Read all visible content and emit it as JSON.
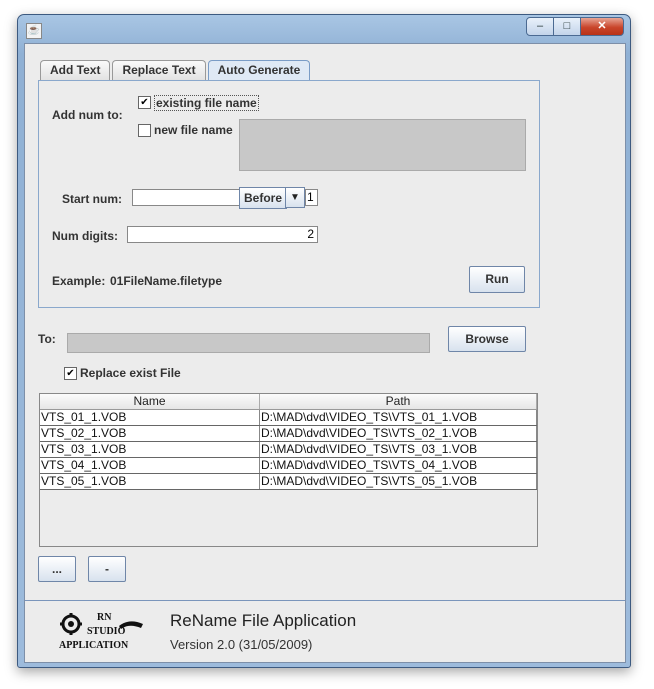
{
  "window": {
    "title": "",
    "controls": {
      "minimize": "‒",
      "maximize": "□",
      "close": "✕"
    }
  },
  "tabs": [
    {
      "label": "Add Text",
      "active": false
    },
    {
      "label": "Replace Text",
      "active": false
    },
    {
      "label": "Auto Generate",
      "active": true
    }
  ],
  "auto_generate": {
    "add_num_label": "Add num to:",
    "existing_file_name": {
      "label": "existing file name",
      "checked": true
    },
    "new_file_name": {
      "label": "new file name",
      "checked": false
    },
    "start_num_label": "Start num:",
    "start_num_value": "",
    "position_select": "Before",
    "position_value": "1",
    "num_digits_label": "Num digits:",
    "num_digits_value": "2",
    "example_label": "Example:",
    "example_value": "01FileName.filetype",
    "run_button": "Run"
  },
  "destination": {
    "to_label": "To:",
    "to_value": "",
    "browse_button": "Browse",
    "replace_exist": {
      "label": "Replace exist File",
      "checked": true
    }
  },
  "files_table": {
    "columns": [
      "Name",
      "Path"
    ],
    "rows": [
      [
        "VTS_01_1.VOB",
        "D:\\MAD\\dvd\\VIDEO_TS\\VTS_01_1.VOB"
      ],
      [
        "VTS_02_1.VOB",
        "D:\\MAD\\dvd\\VIDEO_TS\\VTS_02_1.VOB"
      ],
      [
        "VTS_03_1.VOB",
        "D:\\MAD\\dvd\\VIDEO_TS\\VTS_03_1.VOB"
      ],
      [
        "VTS_04_1.VOB",
        "D:\\MAD\\dvd\\VIDEO_TS\\VTS_04_1.VOB"
      ],
      [
        "VTS_05_1.VOB",
        "D:\\MAD\\dvd\\VIDEO_TS\\VTS_05_1.VOB"
      ]
    ]
  },
  "bottom_buttons": {
    "add": "...",
    "remove": "-"
  },
  "footer": {
    "logo_lines": [
      "RN",
      "STUDIO",
      "APPLICATION"
    ],
    "app_name": "ReName File Application",
    "version": "Version 2.0 (31/05/2009)"
  }
}
